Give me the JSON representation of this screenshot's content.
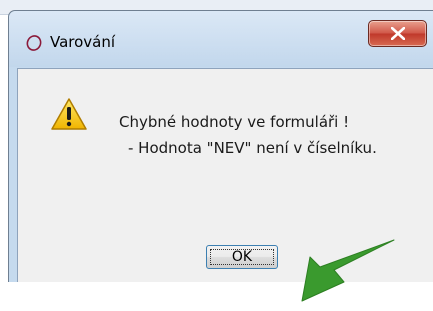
{
  "dialog": {
    "title": "Varování",
    "close_symbol": "X",
    "icons": {
      "app": "ring-icon",
      "warning": "warning-icon",
      "close": "close-icon",
      "annotation": "green-arrow-annotation"
    }
  },
  "message": {
    "line1": "Chybné hodnoty ve formuláři !",
    "line2": "- Hodnota \"NEV\" není v číselníku."
  },
  "buttons": {
    "ok_label": "OK"
  },
  "colors": {
    "window_frame": "#c5daee",
    "client_bg": "#f0f0f0",
    "close_button": "#c0392b",
    "warning_yellow": "#f5c400",
    "arrow_green": "#3a9a2e",
    "ok_focus_border": "#3c7fb1"
  }
}
